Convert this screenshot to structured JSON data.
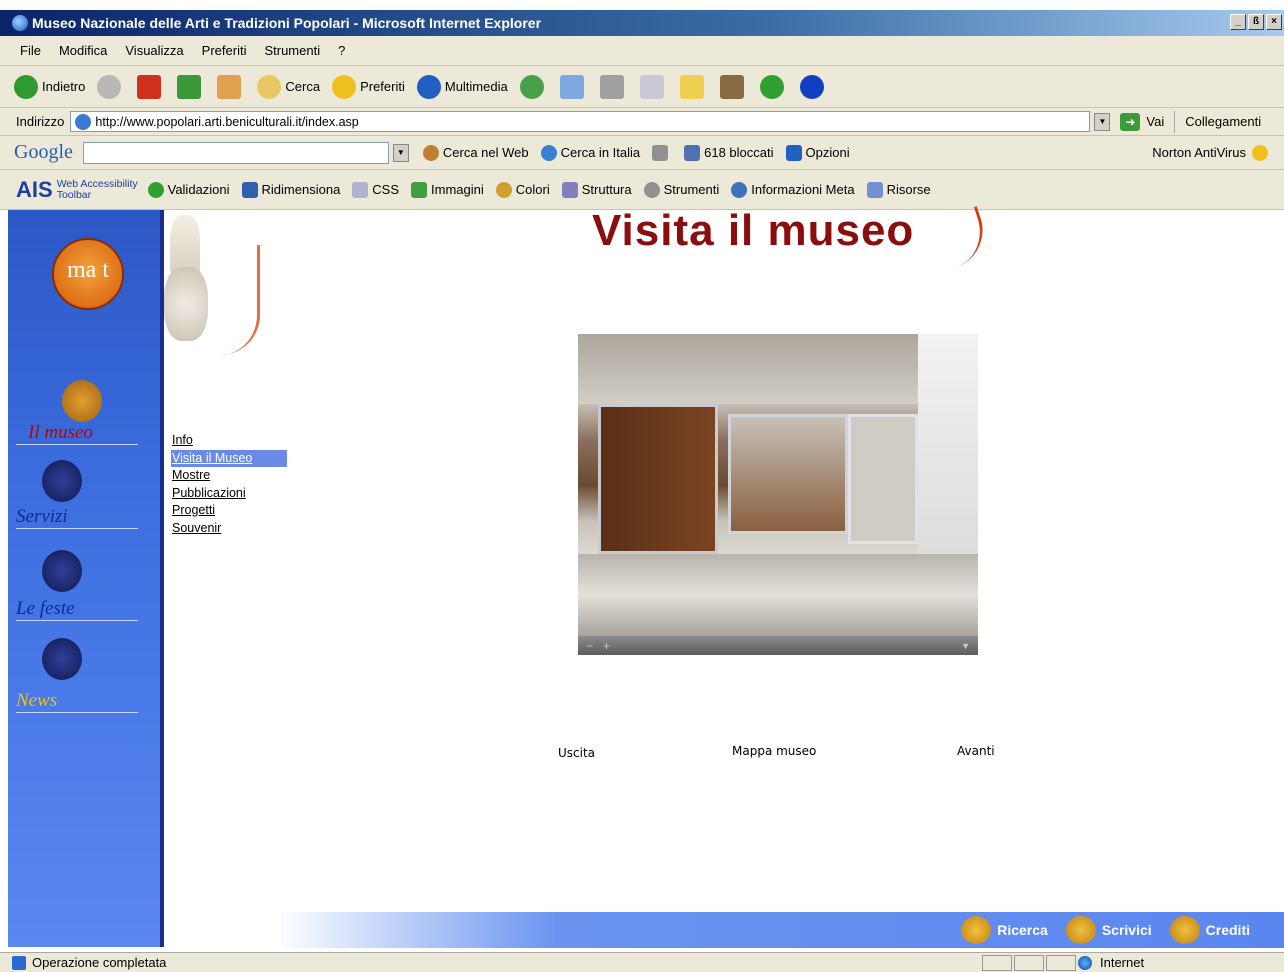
{
  "window": {
    "title": "Museo Nazionale delle Arti e Tradizioni Popolari - Microsoft Internet Explorer",
    "minimize": "_",
    "restore": "ß",
    "close": "×"
  },
  "menu": [
    "File",
    "Modifica",
    "Visualizza",
    "Preferiti",
    "Strumenti",
    "?"
  ],
  "toolbar": {
    "back": "Indietro",
    "search": "Cerca",
    "favorites": "Preferiti",
    "media": "Multimedia"
  },
  "address": {
    "label": "Indirizzo",
    "url": "http://www.popolari.arti.beniculturali.it/index.asp",
    "go": "Vai",
    "links": "Collegamenti"
  },
  "google": {
    "logo": "Google",
    "search_web": "Cerca nel Web",
    "search_italy": "Cerca in Italia",
    "blocked": "618 bloccati",
    "options": "Opzioni",
    "norton": "Norton AntiVirus"
  },
  "ais": {
    "logo": "AIS",
    "sub1": "Web Accessibility",
    "sub2": "Toolbar",
    "items": [
      "Validazioni",
      "Ridimensiona",
      "CSS",
      "Immagini",
      "Colori",
      "Struttura",
      "Strumenti",
      "Informazioni Meta",
      "Risorse"
    ]
  },
  "site": {
    "logo_text": "ma t",
    "nav": [
      {
        "label": "Il museo",
        "color": "#c00000"
      },
      {
        "label": "Servizi",
        "color": "#0a2a9a"
      },
      {
        "label": "Le feste",
        "color": "#0a2a9a"
      },
      {
        "label": "News",
        "color": "#e8c020"
      }
    ],
    "submenu": [
      "Info",
      "Visita il Museo",
      "Mostre",
      "Pubblicazioni",
      "Progetti",
      "Souvenir"
    ],
    "page_title": "Visita il museo",
    "pano_controls": [
      "−",
      "+"
    ],
    "pano_links": {
      "exit": "Uscita",
      "map": "Mappa museo",
      "next": "Avanti"
    },
    "footer": {
      "search": "Ricerca",
      "write": "Scrivici",
      "credits": "Crediti"
    }
  },
  "status": {
    "text": "Operazione completata",
    "zone": "Internet"
  }
}
